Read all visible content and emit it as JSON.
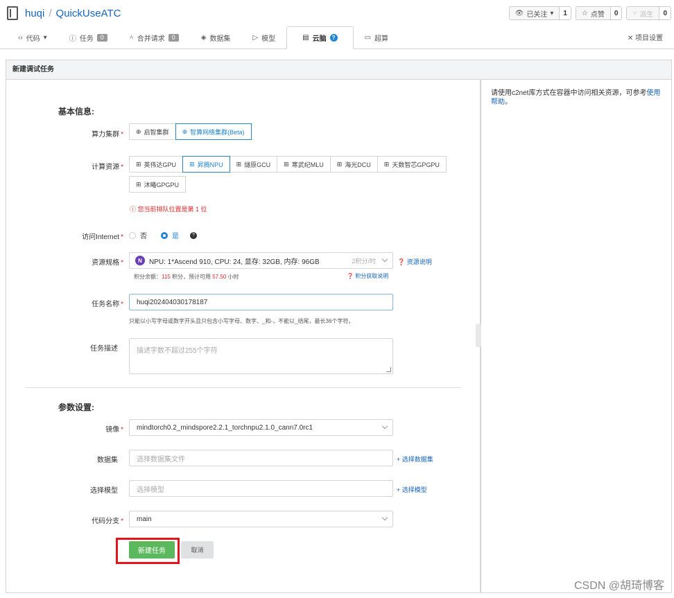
{
  "header": {
    "owner": "huqi",
    "repo": "QuickUseATC",
    "watch_label": "已关注",
    "watch_count": "1",
    "star_label": "点赞",
    "star_count": "0",
    "fork_label": "派生",
    "fork_count": "0"
  },
  "tabs": [
    {
      "label": "代码",
      "badge": ""
    },
    {
      "label": "任务",
      "badge": "0"
    },
    {
      "label": "合并请求",
      "badge": "0"
    },
    {
      "label": "数据集",
      "badge": ""
    },
    {
      "label": "模型",
      "badge": ""
    },
    {
      "label": "云脑",
      "badge": ""
    },
    {
      "label": "超算",
      "badge": ""
    }
  ],
  "tab_settings": "项目设置",
  "section_title": "新建调试任务",
  "side_note": {
    "text": "请使用c2net库方式在容器中访问相关资源，可参考",
    "link": "使用帮助",
    "end": "。"
  },
  "basic_info_title": "基本信息:",
  "cluster": {
    "label": "算力集群",
    "options": [
      "启智集群",
      "智算网络集群(Beta)"
    ],
    "selected": 1
  },
  "compute": {
    "label": "计算资源",
    "options": [
      "英伟达GPU",
      "昇腾NPU",
      "燧原GCU",
      "寒武纪MLU",
      "海光DCU",
      "天数智芯GPGPU",
      "沐曦GPGPU"
    ],
    "selected": 1
  },
  "queue_warning": "您当前排队位置是第 1 位",
  "internet": {
    "label": "访问Internet",
    "no": "否",
    "yes": "是"
  },
  "spec": {
    "label": "资源规格",
    "badge": "N",
    "value": "NPU: 1*Ascend 910, CPU: 24, 显存: 32GB, 内存: 96GB",
    "price": "2积分/时",
    "link": "资源说明",
    "points_prefix": "积分余额：",
    "points_balance": "115",
    "points_mid": " 积分，预计可用 ",
    "points_hours": "57.50",
    "points_suffix": " 小时",
    "points_link": "积分获取说明"
  },
  "task_name": {
    "label": "任务名称",
    "value": "huqi202404030178187",
    "hint": "只能以小写字母或数字开头且只包含小写字母、数字、_和-，不能以_结尾，最长36个字符。"
  },
  "task_desc": {
    "label": "任务描述",
    "placeholder": "描述字数不超过255个字符"
  },
  "params_title": "参数设置:",
  "image": {
    "label": "镜像",
    "value": "mindtorch0.2_mindspore2.2.1_torchnpu2.1.0_cann7.0rc1"
  },
  "dataset": {
    "label": "数据集",
    "placeholder": "选择数据集文件",
    "link": "+ 选择数据集"
  },
  "model": {
    "label": "选择模型",
    "placeholder": "选择模型",
    "link": "+ 选择模型"
  },
  "branch": {
    "label": "代码分支",
    "value": "main"
  },
  "buttons": {
    "create": "新建任务",
    "cancel": "取消"
  },
  "watermark": "CSDN @胡琦博客",
  "colors": {
    "primary": "#2185d0",
    "success": "#5cb85c",
    "danger": "#db2828",
    "highlight": "#e0161c"
  }
}
